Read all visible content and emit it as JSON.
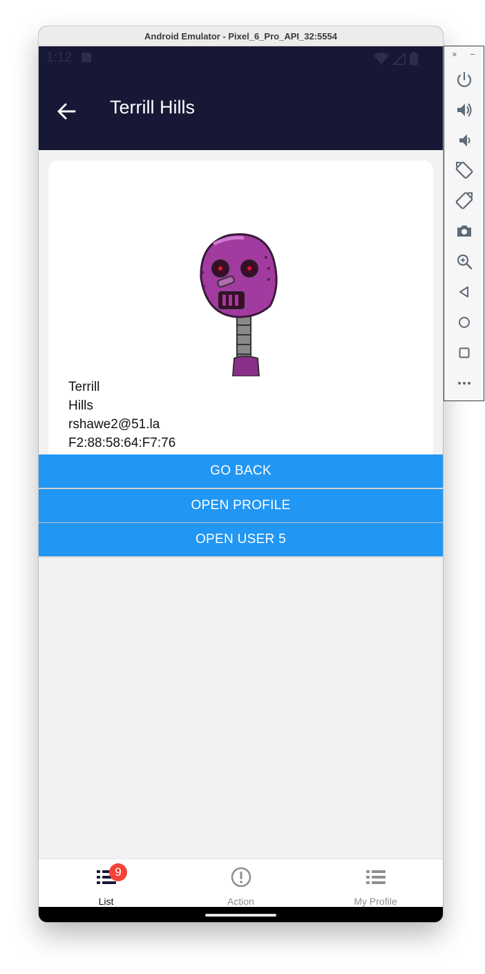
{
  "window": {
    "title": "Android Emulator - Pixel_6_Pro_API_32:5554"
  },
  "status_bar": {
    "time": "1:12"
  },
  "app_bar": {
    "title": "Terrill Hills",
    "back_icon": "arrow-left-icon"
  },
  "profile": {
    "first_name": "Terrill",
    "last_name": "Hills",
    "email": "rshawe2@51.la",
    "mac": "F2:88:58:64:F7:76"
  },
  "buttons": {
    "go_back": "GO BACK",
    "open_profile": "OPEN PROFILE",
    "open_user": "OPEN USER 5"
  },
  "tabs": [
    {
      "label": "List",
      "icon": "list-icon",
      "badge": "9",
      "active": true
    },
    {
      "label": "Action",
      "icon": "alert-circle-icon",
      "active": false
    },
    {
      "label": "My Profile",
      "icon": "list-icon",
      "active": false
    }
  ],
  "colors": {
    "app_bar": "#171835",
    "button": "#2196f3",
    "badge": "#f44336",
    "screen_bg": "#f2f2f2"
  },
  "emulator_toolbar": {
    "close": "×",
    "minimize": "−",
    "icons": [
      "power-icon",
      "volume-up-icon",
      "volume-down-icon",
      "rotate-left-icon",
      "rotate-right-icon",
      "camera-icon",
      "zoom-icon",
      "back-icon",
      "home-icon",
      "overview-icon",
      "more-icon"
    ]
  }
}
